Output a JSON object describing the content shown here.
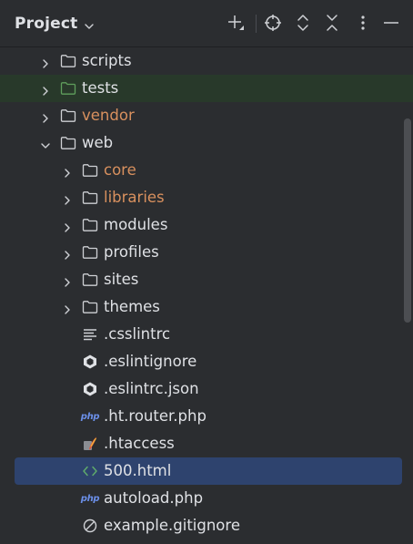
{
  "header": {
    "title": "Project"
  },
  "toolbar": {
    "icons": [
      "add-icon",
      "locate-icon",
      "expand-all-icon",
      "collapse-all-icon",
      "more-options-icon",
      "minimize-icon"
    ]
  },
  "colors": {
    "background": "#2b2d30",
    "text": "#dfe1e5",
    "excluded_orange": "#d8905e",
    "test_folder_bg": "#28392a",
    "test_folder_icon": "#5f9e5c",
    "selection": "#2e436e",
    "php_badge": "#6b8fe8",
    "html_icon": "#5faa6b"
  },
  "tree": {
    "items": [
      {
        "label": "scripts",
        "type": "folder",
        "expanded": false
      },
      {
        "label": "tests",
        "type": "test-folder",
        "expanded": false
      },
      {
        "label": "vendor",
        "type": "folder",
        "expanded": false,
        "excluded": true
      },
      {
        "label": "web",
        "type": "folder",
        "expanded": true
      },
      {
        "label": "core",
        "type": "folder",
        "expanded": false,
        "excluded": true
      },
      {
        "label": "libraries",
        "type": "folder",
        "expanded": false,
        "excluded": true
      },
      {
        "label": "modules",
        "type": "folder",
        "expanded": false
      },
      {
        "label": "profiles",
        "type": "folder",
        "expanded": false
      },
      {
        "label": "sites",
        "type": "folder",
        "expanded": false
      },
      {
        "label": "themes",
        "type": "folder",
        "expanded": false
      },
      {
        "label": ".csslintrc",
        "type": "text-file"
      },
      {
        "label": ".eslintignore",
        "type": "eslint-file"
      },
      {
        "label": ".eslintrc.json",
        "type": "eslint-file"
      },
      {
        "label": ".ht.router.php",
        "type": "php-file",
        "badge": "php"
      },
      {
        "label": ".htaccess",
        "type": "htaccess-file"
      },
      {
        "label": "500.html",
        "type": "html-file",
        "selected": true
      },
      {
        "label": "autoload.php",
        "type": "php-file",
        "badge": "php"
      },
      {
        "label": "example.gitignore",
        "type": "ignore-file"
      }
    ]
  }
}
